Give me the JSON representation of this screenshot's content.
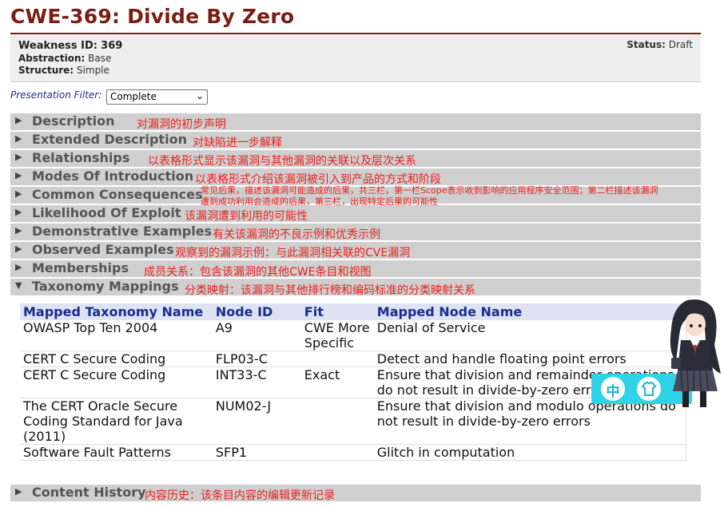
{
  "page": {
    "title": "CWE-369: Divide By Zero"
  },
  "info": {
    "weakness_id_label": "Weakness ID:",
    "weakness_id": "369",
    "abstraction_label": "Abstraction:",
    "abstraction": "Base",
    "structure_label": "Structure:",
    "structure": "Simple",
    "status_label": "Status:",
    "status": "Draft"
  },
  "filter": {
    "label": "Presentation Filter:",
    "selected": "Complete"
  },
  "sections": [
    {
      "label": "Description",
      "note": "对漏洞的初步声明"
    },
    {
      "label": "Extended Description",
      "note": "对缺陷进一步解释"
    },
    {
      "label": "Relationships",
      "note": "以表格形式显示该漏洞与其他漏洞的关联以及层次关系"
    },
    {
      "label": "Modes Of Introduction",
      "note": "以表格形式介绍该漏洞被引入到产品的方式和阶段"
    },
    {
      "label": "Common Consequences",
      "note_line1": "常见后果，描述该漏洞可能造成的后果，共三栏，第一栏Scope表示收到影响的应用程序安全范围；第二栏描述该漏洞",
      "note_line2": "遭到成功利用会造成的后果，第三栏，出现特定后果的可能性"
    },
    {
      "label": "Likelihood Of Exploit",
      "note": "该漏洞遭到利用的可能性"
    },
    {
      "label": "Demonstrative Examples",
      "note": "有关该漏洞的不良示例和优秀示例"
    },
    {
      "label": "Observed Examples",
      "note": "观察到的漏洞示例：与此漏洞相关联的CVE漏洞"
    },
    {
      "label": "Memberships",
      "note": "成员关系：包含该漏洞的其他CWE条目和视图"
    },
    {
      "label": "Taxonomy Mappings",
      "note": "分类映射：该漏洞与其他排行榜和编码标准的分类映射关系"
    }
  ],
  "taxonomy": {
    "headers": [
      "Mapped Taxonomy Name",
      "Node ID",
      "Fit",
      "Mapped Node Name"
    ],
    "rows": [
      [
        "OWASP Top Ten 2004",
        "A9",
        "CWE More Specific",
        "Denial of Service"
      ],
      [
        "CERT C Secure Coding",
        "FLP03-C",
        "",
        "Detect and handle floating point errors"
      ],
      [
        "CERT C Secure Coding",
        "INT33-C",
        "Exact",
        "Ensure that division and remainder operations do not result in divide-by-zero errors"
      ],
      [
        "The CERT Oracle Secure Coding Standard for Java (2011)",
        "NUM02-J",
        "",
        "Ensure that division and modulo operations do not result in divide-by-zero errors"
      ],
      [
        "Software Fault Patterns",
        "SFP1",
        "",
        "Glitch in computation"
      ]
    ]
  },
  "content_history": {
    "label": "Content History",
    "note": "内容历史：该条目内容的编辑更新记录"
  },
  "widget": {
    "chinese_label": "中",
    "shirt_icon": "shirt-icon"
  },
  "colors": {
    "title": "#7a1d14",
    "section_bg": "#cfcfcf",
    "annotation": "#e8211d",
    "table_header_bg": "#dde3f3",
    "table_header_text": "#1c2c8c",
    "widget": "#2fd3e7"
  }
}
